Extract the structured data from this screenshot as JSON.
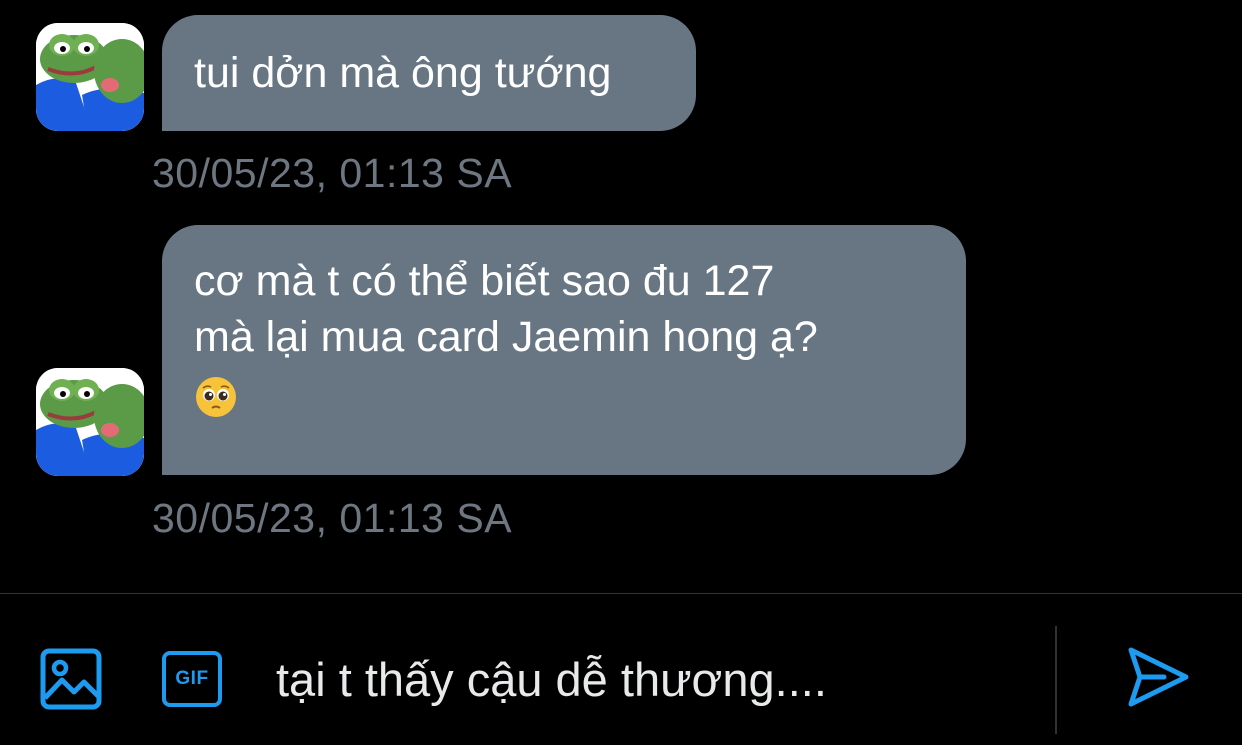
{
  "conversation": {
    "messages": [
      {
        "text_lines": [
          "tui dởn mà ông tướng"
        ],
        "timestamp": "30/05/23, 01:13 SA",
        "avatar_icon": "frog-avatar-icon"
      },
      {
        "text_lines": [
          "cơ mà t có thể biết sao đu 127",
          "mà lại mua card Jaemin hong ạ?"
        ],
        "emoji": "pleading-face-emoji",
        "timestamp": "30/05/23, 01:13 SA",
        "avatar_icon": "frog-avatar-icon"
      }
    ]
  },
  "composer": {
    "media_icon": "image-icon",
    "gif_label": "GIF",
    "input_value": "tại t thấy cậu dễ thương....",
    "send_icon": "send-icon"
  },
  "colors": {
    "background": "#000000",
    "bubble": "#687684",
    "timestamp": "#6e7781",
    "accent": "#1d9bf0",
    "input_text": "#e7e9ea"
  }
}
